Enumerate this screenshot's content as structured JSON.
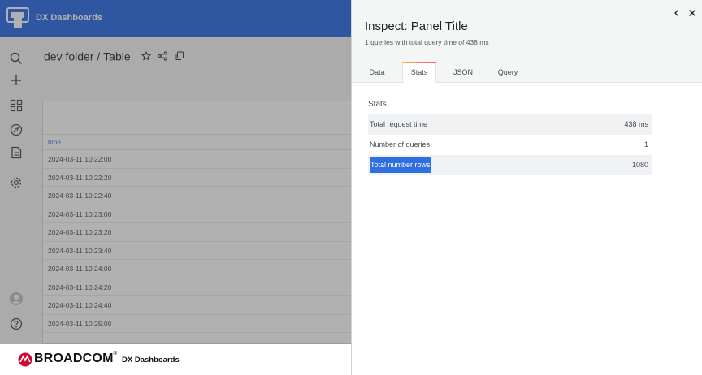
{
  "app": {
    "name": "DX Dashboards",
    "breadcrumb": {
      "folder": "dev folder",
      "separator": "/",
      "dashboard": "Table"
    }
  },
  "sidenav": {
    "items": [
      {
        "name": "search-icon"
      },
      {
        "name": "plus-icon"
      },
      {
        "name": "dashboards-grid-icon"
      },
      {
        "name": "compass-icon"
      },
      {
        "name": "document-icon"
      },
      {
        "name": "gear-icon"
      },
      {
        "name": "user-avatar-icon"
      },
      {
        "name": "help-icon"
      }
    ]
  },
  "table": {
    "column_header": "time",
    "rows": [
      "2024-03-11 10:22:00",
      "2024-03-11 10:22:20",
      "2024-03-11 10:22:40",
      "2024-03-11 10:23:00",
      "2024-03-11 10:23:20",
      "2024-03-11 10:23:40",
      "2024-03-11 10:24:00",
      "2024-03-11 10:24:20",
      "2024-03-11 10:24:40",
      "2024-03-11 10:25:00"
    ]
  },
  "footer": {
    "brand": "BROADCOM",
    "trademark": "®",
    "app": "DX Dashboards"
  },
  "inspect": {
    "title": "Inspect: Panel Title",
    "subtitle": "1 queries with total query time of 438 ms",
    "tabs": [
      {
        "label": "Data",
        "active": false
      },
      {
        "label": "Stats",
        "active": true
      },
      {
        "label": "JSON",
        "active": false
      },
      {
        "label": "Query",
        "active": false
      }
    ],
    "stats_heading": "Stats",
    "stats": [
      {
        "label": "Total request time",
        "value": "438 ms"
      },
      {
        "label": "Number of queries",
        "value": "1"
      },
      {
        "label": "Total number rows",
        "value": "1080"
      }
    ]
  },
  "colors": {
    "brand_blue": "#1f62e0",
    "selection": "#2f6fe0",
    "broadcom_red": "#cc092f"
  }
}
